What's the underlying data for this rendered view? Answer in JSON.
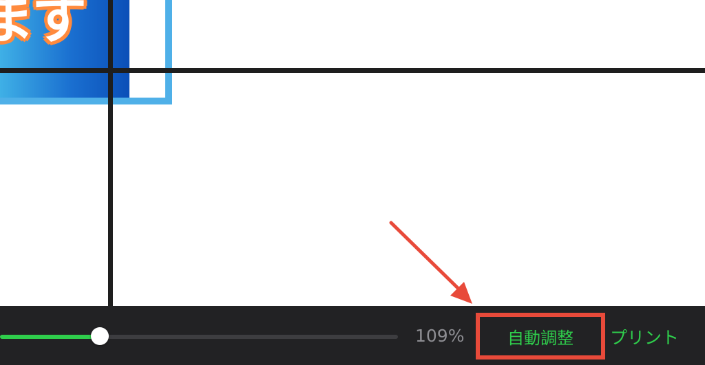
{
  "canvas": {
    "banner_text": "ます"
  },
  "toolbar": {
    "zoom_level": "109%",
    "zoom_slider_fraction": 0.25,
    "autofit_label": "自動調整",
    "print_label": "プリント"
  },
  "colors": {
    "accent_green": "#2fce4c",
    "toolbar_bg": "#222224",
    "highlight_red": "#e84a3a",
    "zoom_text": "#8d8d92"
  },
  "annotation": {
    "arrow_icon": "red-arrow-icon",
    "highlight": "red-highlight-box"
  }
}
